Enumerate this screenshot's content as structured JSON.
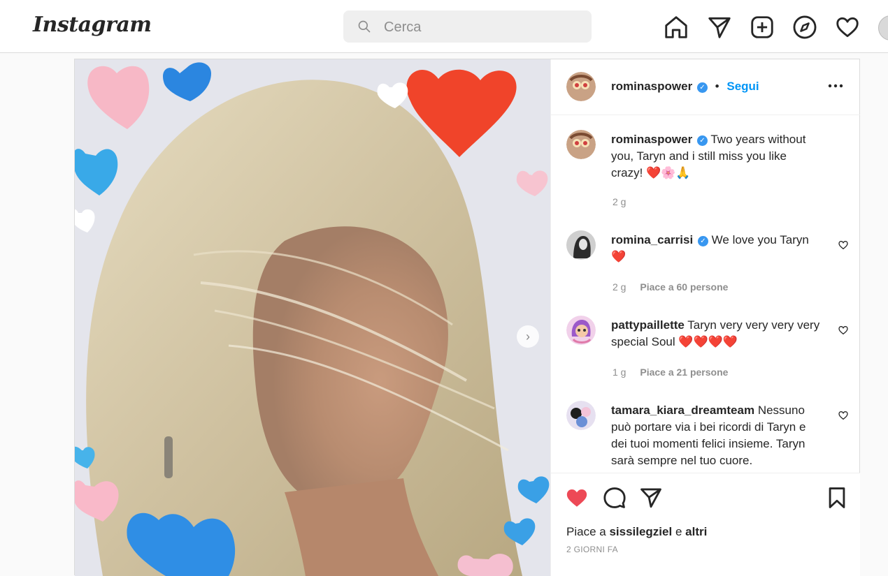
{
  "app": {
    "logo": "Instagram"
  },
  "search": {
    "placeholder": "Cerca"
  },
  "nav": {
    "icons": [
      "home-icon",
      "direct-icon",
      "new-post-icon",
      "explore-icon",
      "activity-heart-icon",
      "profile-avatar"
    ]
  },
  "post": {
    "author": "rominaspower",
    "follow_label": "Segui",
    "separator": "•",
    "caption": {
      "username": "rominaspower",
      "text": "Two years without you, Taryn and i still miss you like crazy! ❤️🌸🙏",
      "time": "2 g"
    },
    "comments": [
      {
        "username": "romina_carrisi",
        "verified": true,
        "text": "We love you Taryn ❤️",
        "time": "2 g",
        "likes": "Piace a 60 persone"
      },
      {
        "username": "pattypaillette",
        "verified": false,
        "text": "Taryn very very very very special Soul ❤️❤️❤️❤️",
        "time": "1 g",
        "likes": "Piace a 21 persone"
      },
      {
        "username": "tamara_kiara_dreamteam",
        "verified": false,
        "text": "Nessuno può portare via i bei ricordi di Taryn e dei tuoi momenti felici insieme. Taryn sarà sempre nel tuo cuore.",
        "time": "",
        "likes": ""
      }
    ],
    "liked_by": {
      "prefix": "Piace a",
      "user": "sissilegziel",
      "conj": "e",
      "others": "altri"
    },
    "time_ago": "2 GIORNI FA"
  },
  "colors": {
    "accent": "#0095f6",
    "like": "#ed4956",
    "verified": "#3897f0"
  }
}
